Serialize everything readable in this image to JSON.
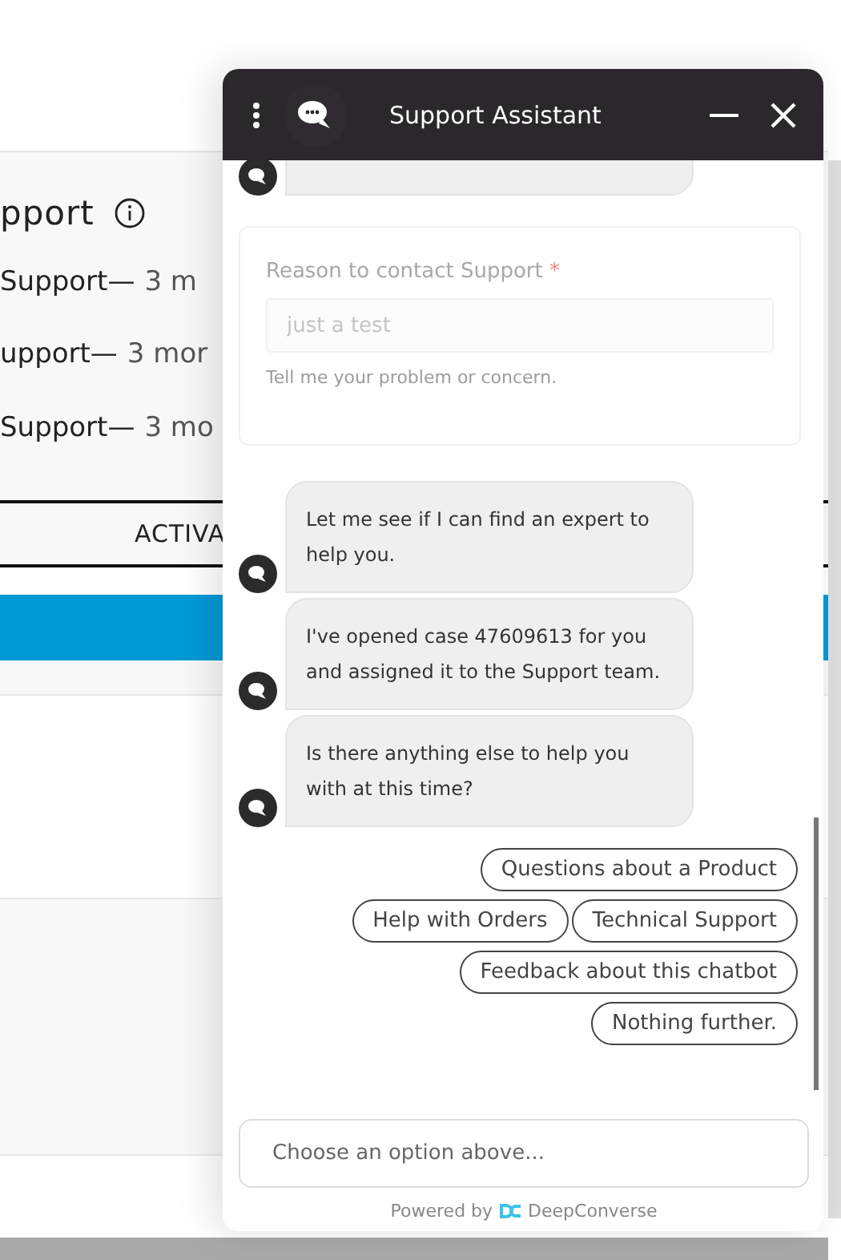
{
  "page": {
    "heading": "pport",
    "rows": [
      {
        "label": "Support—",
        "time": "3 m"
      },
      {
        "label": "upport—",
        "time": "3 mor"
      },
      {
        "label": "Support—",
        "time": "3 mo"
      }
    ],
    "tab": "ACTIVA"
  },
  "chat": {
    "title": "Support Assistant",
    "form": {
      "label": "Reason to contact Support",
      "required_mark": "*",
      "value": "just a test",
      "help": "Tell me your problem or concern."
    },
    "messages": [
      "Let me see if I can find an expert to help you.",
      "I've opened case 47609613 for you and assigned it to the Support team.",
      "Is there anything else to help you with at this time?"
    ],
    "options": [
      [
        "Questions about a Product"
      ],
      [
        "Help with Orders",
        "Technical Support"
      ],
      [
        "Feedback about this chatbot"
      ],
      [
        "Nothing further."
      ]
    ],
    "input": {
      "placeholder": "Choose an option above..."
    },
    "footer": {
      "prefix": "Powered by",
      "brand": "DeepConverse"
    }
  }
}
